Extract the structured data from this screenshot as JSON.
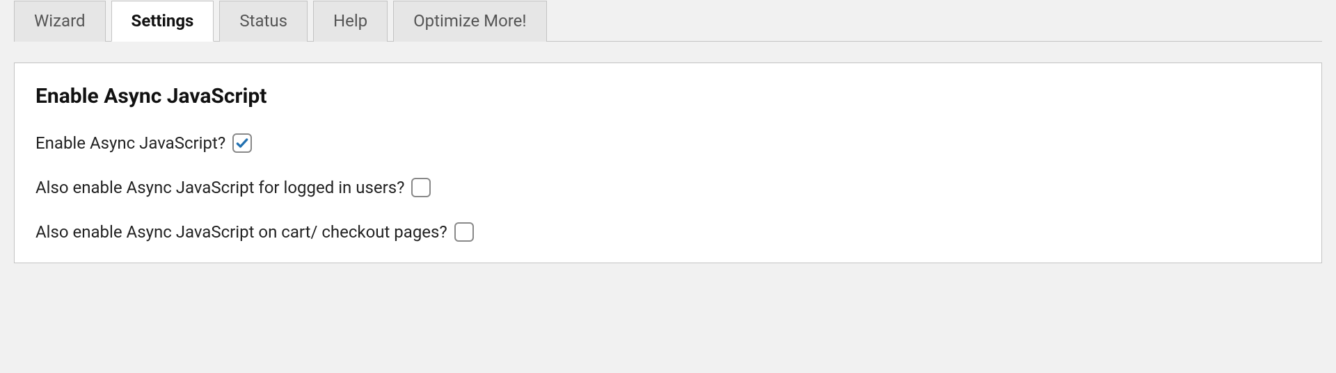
{
  "tabs": [
    {
      "label": "Wizard",
      "active": false
    },
    {
      "label": "Settings",
      "active": true
    },
    {
      "label": "Status",
      "active": false
    },
    {
      "label": "Help",
      "active": false
    },
    {
      "label": "Optimize More!",
      "active": false
    }
  ],
  "section": {
    "title": "Enable Async JavaScript",
    "options": [
      {
        "label": "Enable Async JavaScript?",
        "checked": true
      },
      {
        "label": "Also enable Async JavaScript for logged in users?",
        "checked": false
      },
      {
        "label": "Also enable Async JavaScript on cart/ checkout pages?",
        "checked": false
      }
    ]
  },
  "colors": {
    "check": "#2271b1"
  }
}
